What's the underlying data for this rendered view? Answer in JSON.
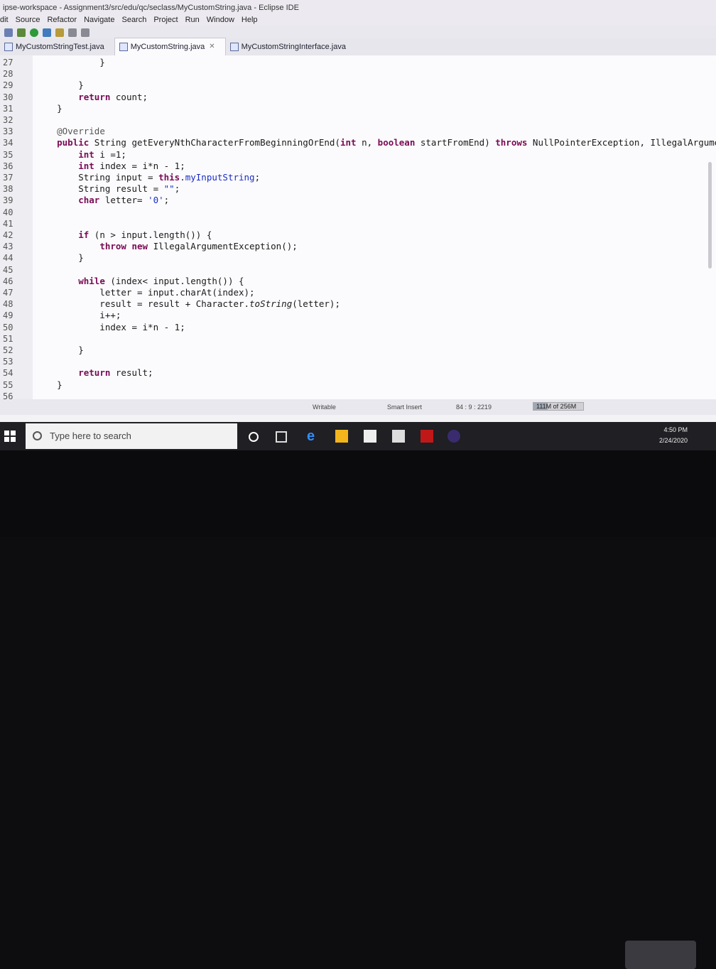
{
  "window": {
    "title": "ipse-workspace - Assignment3/src/edu/qc/seclass/MyCustomString.java - Eclipse IDE"
  },
  "menu": [
    "dit",
    "Source",
    "Refactor",
    "Navigate",
    "Search",
    "Project",
    "Run",
    "Window",
    "Help"
  ],
  "tabs": [
    {
      "label": "MyCustomStringTest.java",
      "active": false
    },
    {
      "label": "MyCustomString.java",
      "active": true
    },
    {
      "label": "MyCustomStringInterface.java",
      "active": false
    }
  ],
  "code_lines": [
    {
      "n": "27",
      "text": "            }"
    },
    {
      "n": "28",
      "text": ""
    },
    {
      "n": "29",
      "text": "        }"
    },
    {
      "n": "30",
      "text": "        return count;"
    },
    {
      "n": "31",
      "text": "    }"
    },
    {
      "n": "32",
      "text": ""
    },
    {
      "n": "33",
      "text": "    @Override"
    },
    {
      "n": "34",
      "text": "    public String getEveryNthCharacterFromBeginningOrEnd(int n, boolean startFromEnd) throws NullPointerException, IllegalArgumentExcept"
    },
    {
      "n": "35",
      "text": "        int i =1;"
    },
    {
      "n": "36",
      "text": "        int index = i*n - 1;"
    },
    {
      "n": "37",
      "text": "        String input = this.myInputString;"
    },
    {
      "n": "38",
      "text": "        String result = \"\";"
    },
    {
      "n": "39",
      "text": "        char letter= '0';"
    },
    {
      "n": "40",
      "text": ""
    },
    {
      "n": "41",
      "text": ""
    },
    {
      "n": "42",
      "text": "        if (n > input.length()) {"
    },
    {
      "n": "43",
      "text": "            throw new IllegalArgumentException();"
    },
    {
      "n": "44",
      "text": "        }"
    },
    {
      "n": "45",
      "text": ""
    },
    {
      "n": "46",
      "text": "        while (index< input.length()) {"
    },
    {
      "n": "47",
      "text": "            letter = input.charAt(index);"
    },
    {
      "n": "48",
      "text": "            result = result + Character.toString(letter);"
    },
    {
      "n": "49",
      "text": "            i++;"
    },
    {
      "n": "50",
      "text": "            index = i*n - 1;"
    },
    {
      "n": "51",
      "text": ""
    },
    {
      "n": "52",
      "text": "        }"
    },
    {
      "n": "53",
      "text": ""
    },
    {
      "n": "54",
      "text": "        return result;"
    },
    {
      "n": "55",
      "text": "    }"
    },
    {
      "n": "56",
      "text": ""
    }
  ],
  "status": {
    "writable": "Writable",
    "insert_mode": "Smart Insert",
    "position": "84 : 9 : 2219",
    "heap": "111M of 256M"
  },
  "taskbar": {
    "search_placeholder": "Type here to search",
    "time": "4:50 PM",
    "date": "2/24/2020"
  }
}
